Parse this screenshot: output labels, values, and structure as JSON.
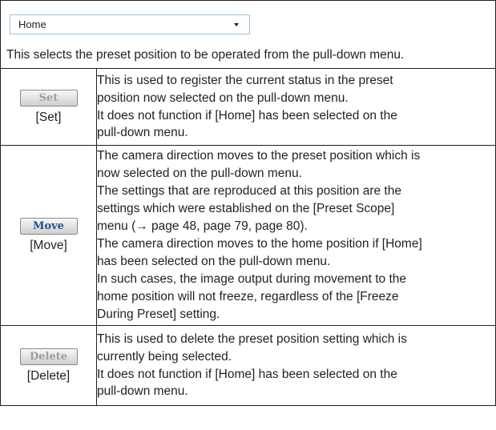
{
  "pulldown": {
    "selected": "Home"
  },
  "intro_text": "This selects the preset position to be operated from the pull-down menu.",
  "rows": [
    {
      "button_text": "Set",
      "caption": "[Set]",
      "lines": [
        "This is used to register the current status in the preset",
        "position now selected on the pull-down menu.",
        "It does not function if [Home] has been selected on the",
        "pull-down menu."
      ]
    },
    {
      "button_text": "Move",
      "caption": "[Move]",
      "lines": [
        "The camera direction moves to the preset position which is",
        "now selected on the pull-down menu.",
        "The settings that are reproduced at this position are the",
        "settings which were established on the [Preset Scope]",
        "menu (→ page 48, page 79, page 80).",
        "The camera direction moves to the home position if [Home]",
        "has been selected on the pull-down menu.",
        "In such cases, the image output during movement to the",
        "home position will not freeze, regardless of the [Freeze",
        "During Preset] setting."
      ]
    },
    {
      "button_text": "Delete",
      "caption": "[Delete]",
      "lines": [
        "This is used to delete the preset position setting which is",
        "currently being selected.",
        "It does not function if [Home] has been selected on the",
        "pull-down menu."
      ]
    }
  ],
  "colors": {
    "text": "#231f20",
    "pulldown_border": "#9cc3df",
    "button_disabled_text": "#9a9fa6",
    "button_enabled_text": "#1f4f8f"
  }
}
